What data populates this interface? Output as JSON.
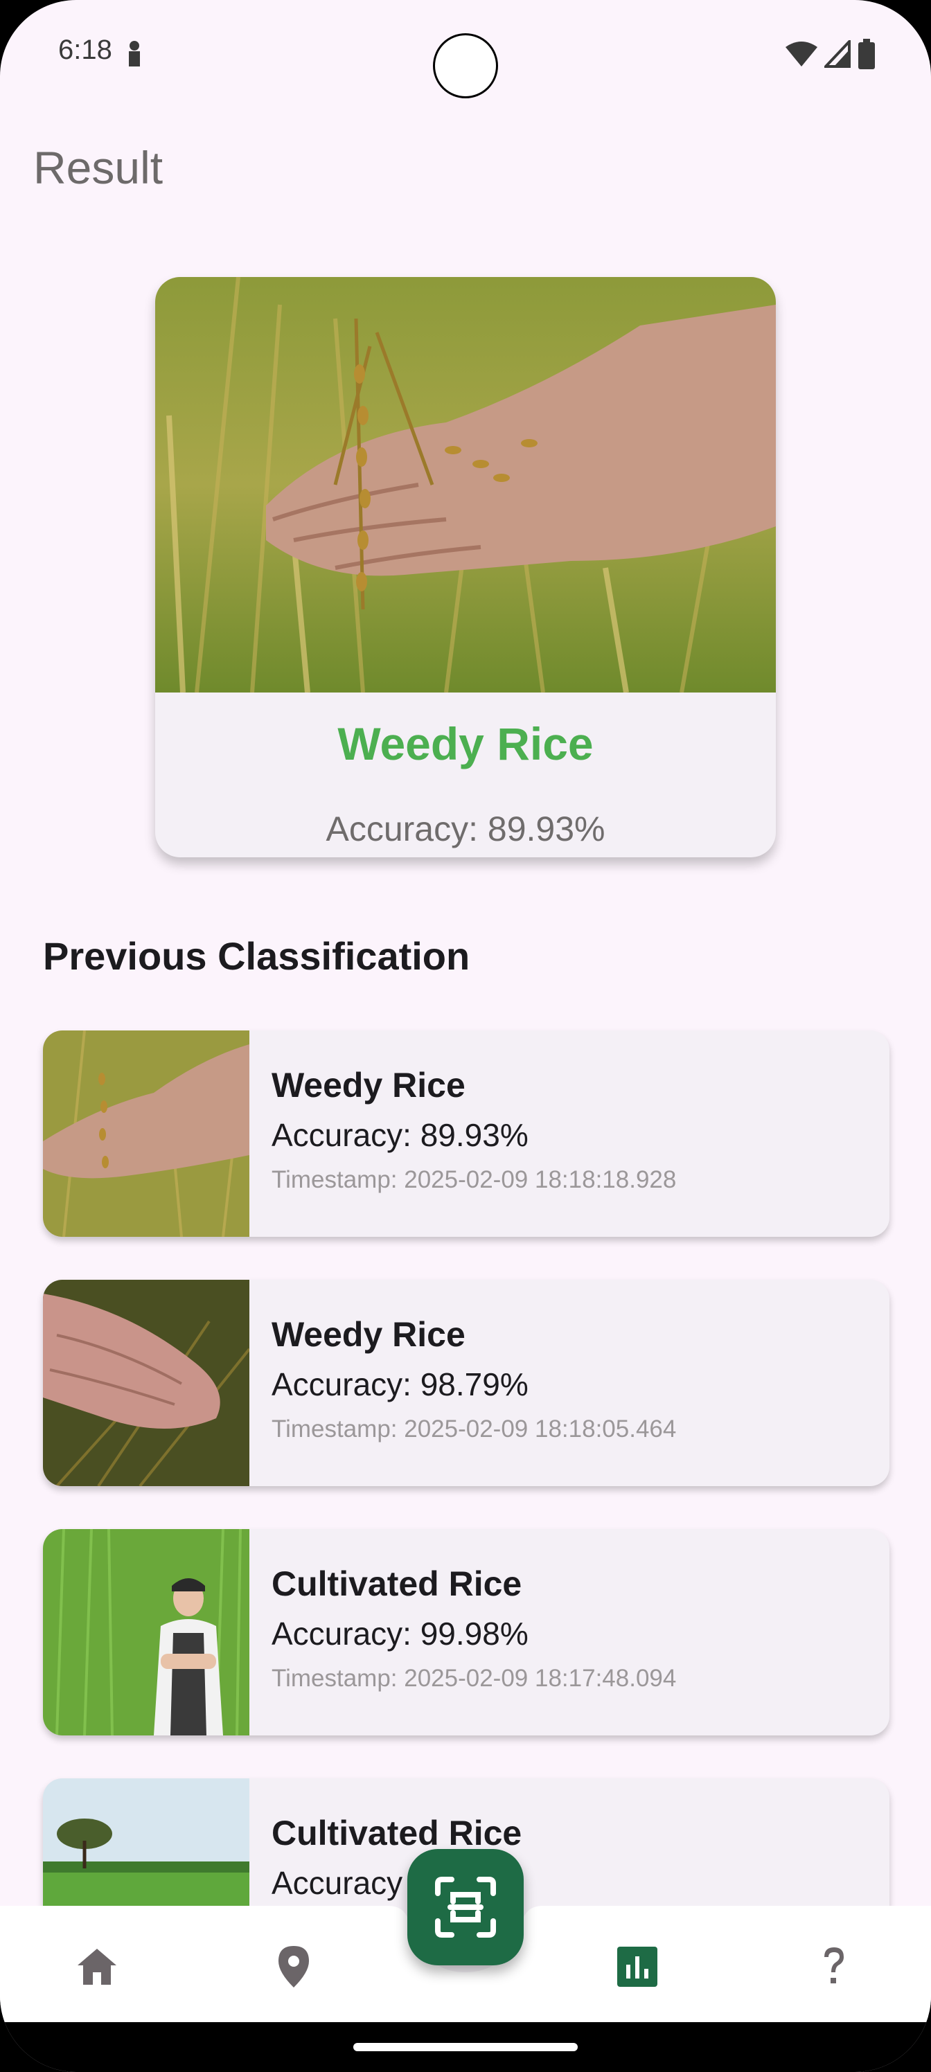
{
  "status_bar": {
    "time": "6:18"
  },
  "header": {
    "title": "Result"
  },
  "result": {
    "label": "Weedy Rice",
    "accuracy": "Accuracy: 89.93%",
    "label_color": "#4caf50"
  },
  "history": {
    "heading": "Previous Classification",
    "items": [
      {
        "label": "Weedy Rice",
        "accuracy": "Accuracy: 89.93%",
        "timestamp": "Timestamp: 2025-02-09 18:18:18.928"
      },
      {
        "label": "Weedy Rice",
        "accuracy": "Accuracy: 98.79%",
        "timestamp": "Timestamp: 2025-02-09 18:18:05.464"
      },
      {
        "label": "Cultivated Rice",
        "accuracy": "Accuracy: 99.98%",
        "timestamp": "Timestamp: 2025-02-09 18:17:48.094"
      },
      {
        "label": "Cultivated Rice",
        "accuracy": "Accuracy",
        "tail": "%"
      }
    ]
  },
  "nav": {
    "items": [
      "home-icon",
      "location-pin-icon",
      "scan-icon",
      "bar-chart-icon",
      "help-icon"
    ],
    "active": "bar-chart-icon",
    "accent": "#1e6b45",
    "icon_color": "#6b6568"
  }
}
